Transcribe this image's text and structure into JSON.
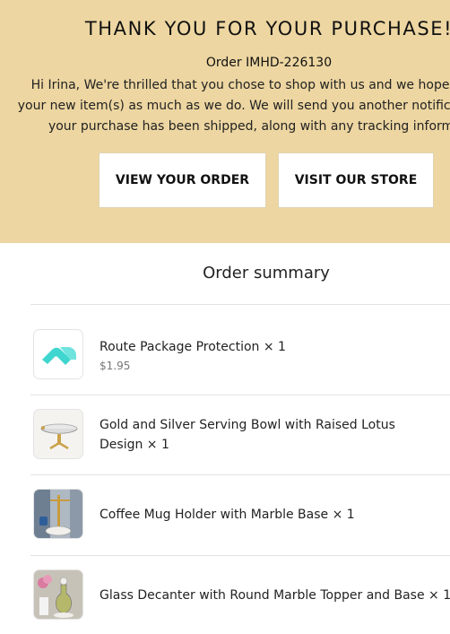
{
  "header": {
    "title": "THANK YOU FOR YOUR PURCHASE!",
    "order_number": "Order IMHD-226130",
    "message_lines": [
      "Hi Irina, We're thrilled that you chose to shop with us and we hope you love",
      "your new item(s) as much as we do. We will send you another notification when",
      "your purchase has been shipped, along with any tracking information."
    ],
    "buttons": {
      "view_order": "VIEW YOUR ORDER",
      "visit_store": "VISIT OUR STORE"
    }
  },
  "summary": {
    "title": "Order summary",
    "items": [
      {
        "name_lines": [
          "Route Package Protection × 1"
        ],
        "price": "$1.95",
        "icon": "route-logo-icon"
      },
      {
        "name_lines": [
          "Gold and Silver Serving Bowl with Raised Lotus",
          "Design × 1"
        ],
        "icon": "serving-bowl-image"
      },
      {
        "name_lines": [
          "Coffee Mug Holder with Marble Base × 1"
        ],
        "icon": "mug-holder-image"
      },
      {
        "name_lines": [
          "Glass Decanter with Round Marble Topper and Base × 1"
        ],
        "icon": "decanter-image"
      }
    ]
  },
  "colors": {
    "hero_background": "#edd6a1",
    "button_background": "#ffffff",
    "route_logo": "#3fd6cf"
  }
}
